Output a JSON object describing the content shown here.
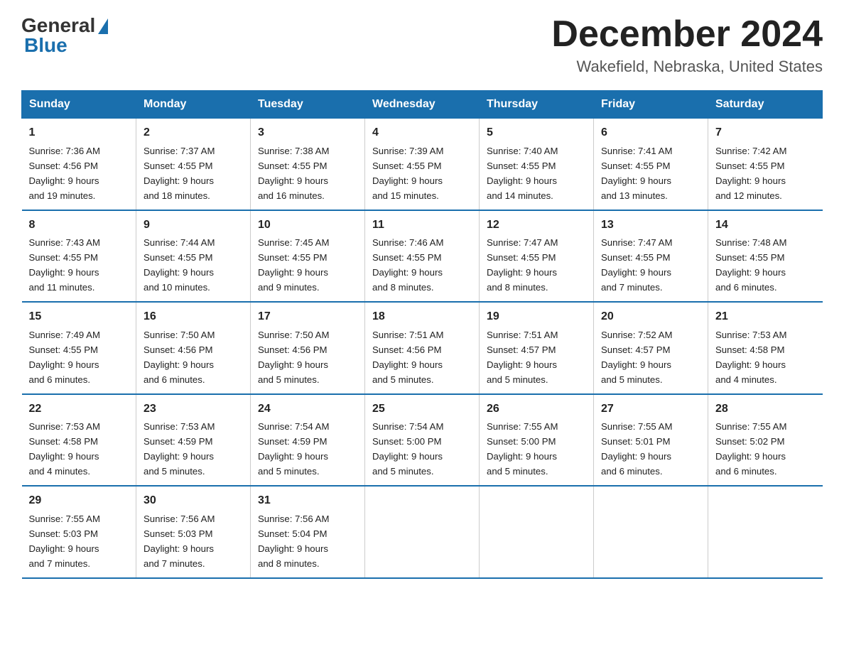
{
  "header": {
    "logo_general": "General",
    "logo_blue": "Blue",
    "month_title": "December 2024",
    "location": "Wakefield, Nebraska, United States"
  },
  "days_of_week": [
    "Sunday",
    "Monday",
    "Tuesday",
    "Wednesday",
    "Thursday",
    "Friday",
    "Saturday"
  ],
  "weeks": [
    [
      {
        "day": "1",
        "sunrise": "7:36 AM",
        "sunset": "4:56 PM",
        "daylight": "9 hours and 19 minutes."
      },
      {
        "day": "2",
        "sunrise": "7:37 AM",
        "sunset": "4:55 PM",
        "daylight": "9 hours and 18 minutes."
      },
      {
        "day": "3",
        "sunrise": "7:38 AM",
        "sunset": "4:55 PM",
        "daylight": "9 hours and 16 minutes."
      },
      {
        "day": "4",
        "sunrise": "7:39 AM",
        "sunset": "4:55 PM",
        "daylight": "9 hours and 15 minutes."
      },
      {
        "day": "5",
        "sunrise": "7:40 AM",
        "sunset": "4:55 PM",
        "daylight": "9 hours and 14 minutes."
      },
      {
        "day": "6",
        "sunrise": "7:41 AM",
        "sunset": "4:55 PM",
        "daylight": "9 hours and 13 minutes."
      },
      {
        "day": "7",
        "sunrise": "7:42 AM",
        "sunset": "4:55 PM",
        "daylight": "9 hours and 12 minutes."
      }
    ],
    [
      {
        "day": "8",
        "sunrise": "7:43 AM",
        "sunset": "4:55 PM",
        "daylight": "9 hours and 11 minutes."
      },
      {
        "day": "9",
        "sunrise": "7:44 AM",
        "sunset": "4:55 PM",
        "daylight": "9 hours and 10 minutes."
      },
      {
        "day": "10",
        "sunrise": "7:45 AM",
        "sunset": "4:55 PM",
        "daylight": "9 hours and 9 minutes."
      },
      {
        "day": "11",
        "sunrise": "7:46 AM",
        "sunset": "4:55 PM",
        "daylight": "9 hours and 8 minutes."
      },
      {
        "day": "12",
        "sunrise": "7:47 AM",
        "sunset": "4:55 PM",
        "daylight": "9 hours and 8 minutes."
      },
      {
        "day": "13",
        "sunrise": "7:47 AM",
        "sunset": "4:55 PM",
        "daylight": "9 hours and 7 minutes."
      },
      {
        "day": "14",
        "sunrise": "7:48 AM",
        "sunset": "4:55 PM",
        "daylight": "9 hours and 6 minutes."
      }
    ],
    [
      {
        "day": "15",
        "sunrise": "7:49 AM",
        "sunset": "4:55 PM",
        "daylight": "9 hours and 6 minutes."
      },
      {
        "day": "16",
        "sunrise": "7:50 AM",
        "sunset": "4:56 PM",
        "daylight": "9 hours and 6 minutes."
      },
      {
        "day": "17",
        "sunrise": "7:50 AM",
        "sunset": "4:56 PM",
        "daylight": "9 hours and 5 minutes."
      },
      {
        "day": "18",
        "sunrise": "7:51 AM",
        "sunset": "4:56 PM",
        "daylight": "9 hours and 5 minutes."
      },
      {
        "day": "19",
        "sunrise": "7:51 AM",
        "sunset": "4:57 PM",
        "daylight": "9 hours and 5 minutes."
      },
      {
        "day": "20",
        "sunrise": "7:52 AM",
        "sunset": "4:57 PM",
        "daylight": "9 hours and 5 minutes."
      },
      {
        "day": "21",
        "sunrise": "7:53 AM",
        "sunset": "4:58 PM",
        "daylight": "9 hours and 4 minutes."
      }
    ],
    [
      {
        "day": "22",
        "sunrise": "7:53 AM",
        "sunset": "4:58 PM",
        "daylight": "9 hours and 4 minutes."
      },
      {
        "day": "23",
        "sunrise": "7:53 AM",
        "sunset": "4:59 PM",
        "daylight": "9 hours and 5 minutes."
      },
      {
        "day": "24",
        "sunrise": "7:54 AM",
        "sunset": "4:59 PM",
        "daylight": "9 hours and 5 minutes."
      },
      {
        "day": "25",
        "sunrise": "7:54 AM",
        "sunset": "5:00 PM",
        "daylight": "9 hours and 5 minutes."
      },
      {
        "day": "26",
        "sunrise": "7:55 AM",
        "sunset": "5:00 PM",
        "daylight": "9 hours and 5 minutes."
      },
      {
        "day": "27",
        "sunrise": "7:55 AM",
        "sunset": "5:01 PM",
        "daylight": "9 hours and 6 minutes."
      },
      {
        "day": "28",
        "sunrise": "7:55 AM",
        "sunset": "5:02 PM",
        "daylight": "9 hours and 6 minutes."
      }
    ],
    [
      {
        "day": "29",
        "sunrise": "7:55 AM",
        "sunset": "5:03 PM",
        "daylight": "9 hours and 7 minutes."
      },
      {
        "day": "30",
        "sunrise": "7:56 AM",
        "sunset": "5:03 PM",
        "daylight": "9 hours and 7 minutes."
      },
      {
        "day": "31",
        "sunrise": "7:56 AM",
        "sunset": "5:04 PM",
        "daylight": "9 hours and 8 minutes."
      },
      null,
      null,
      null,
      null
    ]
  ]
}
